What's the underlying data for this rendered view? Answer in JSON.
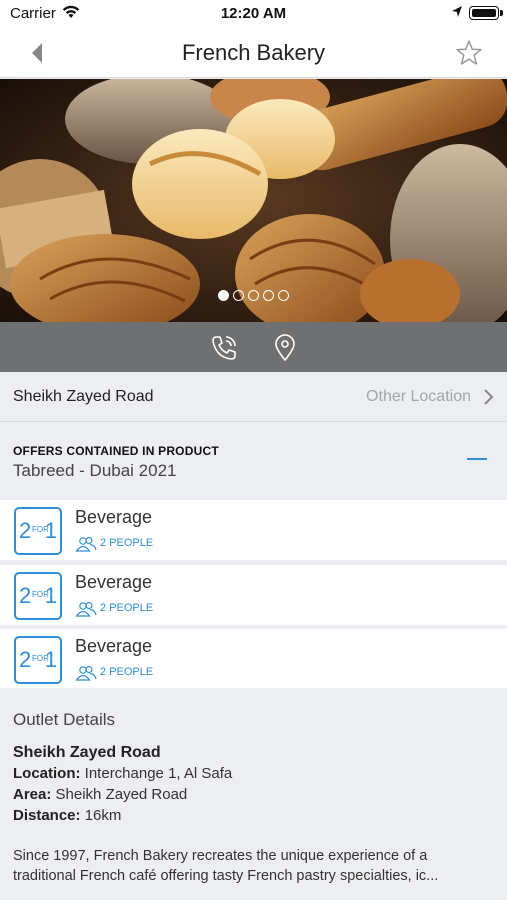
{
  "status": {
    "carrier": "Carrier",
    "time": "12:20 AM"
  },
  "nav": {
    "title": "French Bakery",
    "back_icon": "chevron-left-icon",
    "favorite_icon": "star-icon"
  },
  "gallery": {
    "image": "bakery-breads-photo",
    "slides": 5,
    "active_slide": 1
  },
  "actions": {
    "call_icon": "phone-icon",
    "map_icon": "location-pin-icon"
  },
  "location": {
    "name": "Sheikh Zayed Road",
    "other_label": "Other Location"
  },
  "offers": {
    "header": "OFFERS CONTAINED IN PRODUCT",
    "product": "Tabreed - Dubai 2021",
    "items": [
      {
        "title": "Beverage",
        "people": "2 PEOPLE",
        "badge_two": "2",
        "badge_for": "FOR",
        "badge_one": "1"
      },
      {
        "title": "Beverage",
        "people": "2 PEOPLE",
        "badge_two": "2",
        "badge_for": "FOR",
        "badge_one": "1"
      },
      {
        "title": "Beverage",
        "people": "2 PEOPLE",
        "badge_two": "2",
        "badge_for": "FOR",
        "badge_one": "1"
      }
    ]
  },
  "outlet": {
    "heading": "Outlet Details",
    "name": "Sheikh Zayed Road",
    "location_label": "Location:",
    "location_value": "Interchange 1, Al Safa",
    "area_label": "Area:",
    "area_value": "Sheikh Zayed Road",
    "distance_label": "Distance:",
    "distance_value": "16km",
    "description": "Since 1997, French Bakery recreates the unique experience of a traditional French café offering tasty French pastry specialties, ic..."
  },
  "colors": {
    "accent": "#2e8fd6",
    "action_bar": "#6f7072",
    "background": "#eceef1"
  }
}
